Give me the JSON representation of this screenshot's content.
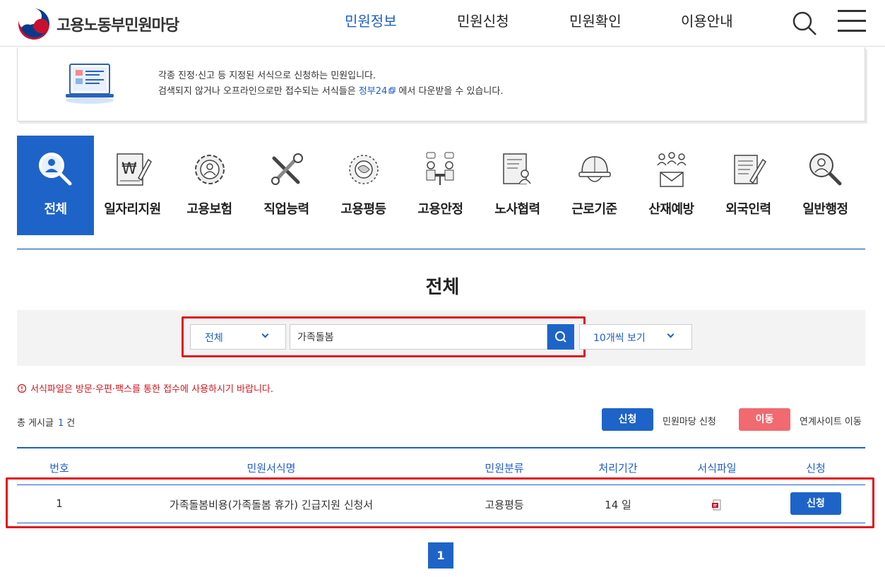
{
  "header": {
    "logo_text": "고용노동부민원마당",
    "nav": [
      "민원정보",
      "민원신청",
      "민원확인",
      "이용안내"
    ],
    "active_nav": "민원정보"
  },
  "info": {
    "line1": "각종 진정·신고 등 지정된 서식으로 신청하는 민원입니다.",
    "line2_pre": "검색되지 않거나 오프라인으로만 접수되는 서식들은 ",
    "line2_link": "정부24",
    "line2_post": " 에서 다운받을 수 있습니다."
  },
  "categories": [
    {
      "label": "전체",
      "icon": "person-search-icon",
      "active": true
    },
    {
      "label": "일자리지원",
      "icon": "won-document-icon"
    },
    {
      "label": "고용보험",
      "icon": "gear-person-icon"
    },
    {
      "label": "직업능력",
      "icon": "tools-icon"
    },
    {
      "label": "고용평등",
      "icon": "globe-people-icon"
    },
    {
      "label": "고용안정",
      "icon": "meeting-icon"
    },
    {
      "label": "노사협력",
      "icon": "document-person-icon"
    },
    {
      "label": "근로기준",
      "icon": "helmet-icon"
    },
    {
      "label": "산재예방",
      "icon": "people-mail-icon"
    },
    {
      "label": "외국인력",
      "icon": "document-pen-icon"
    },
    {
      "label": "일반행정",
      "icon": "person-search-icon"
    }
  ],
  "section_title": "전체",
  "search": {
    "category_value": "전체",
    "query": "가족돌봄",
    "per_page": "10개씩 보기"
  },
  "notice": "서식파일은 방문·우편·팩스를 통한 접수에 사용하시기 바랍니다.",
  "total": {
    "label": "총 게시글",
    "count": "1",
    "unit": "건"
  },
  "legend": {
    "apply_btn": "신청",
    "apply_txt": "민원마당 신청",
    "move_btn": "이동",
    "move_txt": "연계사이트 이동"
  },
  "table": {
    "headers": [
      "번호",
      "민원서식명",
      "민원분류",
      "처리기간",
      "서식파일",
      "신청"
    ],
    "rows": [
      {
        "no": "1",
        "name": "가족돌봄비용(가족돌봄 휴가) 긴급지원 신청서",
        "category": "고용평등",
        "period": "14 일",
        "file_icon": "pdf-file-icon",
        "action": "신청"
      }
    ]
  },
  "pagination": {
    "current": "1"
  },
  "colors": {
    "accent": "#1e64c8",
    "highlight": "#e0141e",
    "move": "#f06a70"
  }
}
